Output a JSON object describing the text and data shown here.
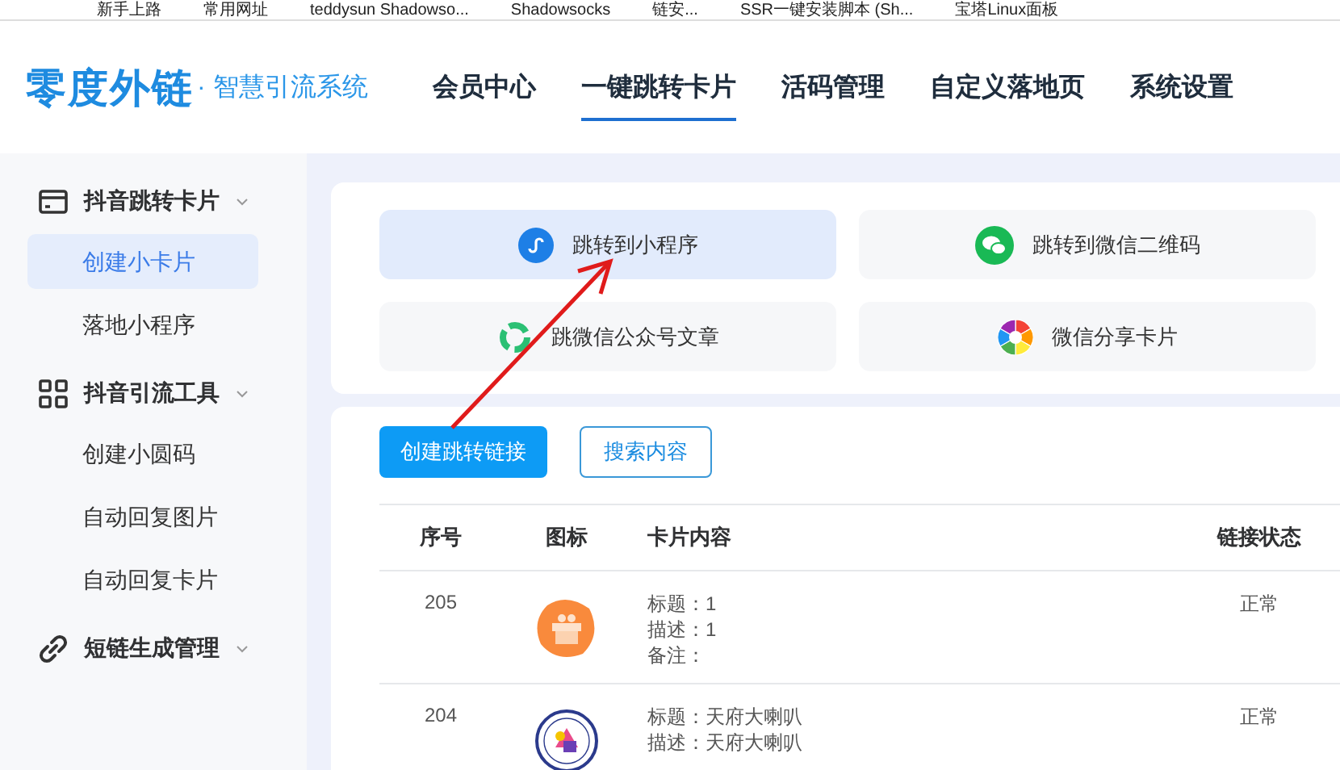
{
  "bookmarks": [
    "新手上路",
    "常用网址",
    "teddysun Shadowso...",
    "Shadowsocks",
    "链安...",
    "SSR一键安装脚本 (Sh...",
    "宝塔Linux面板"
  ],
  "logo": {
    "name": "零度外链",
    "tagline": "· 智慧引流系统"
  },
  "nav": [
    {
      "label": "会员中心",
      "selected": false
    },
    {
      "label": "一键跳转卡片",
      "selected": true
    },
    {
      "label": "活码管理",
      "selected": false
    },
    {
      "label": "自定义落地页",
      "selected": false
    },
    {
      "label": "系统设置",
      "selected": false
    }
  ],
  "sidebar": [
    {
      "label": "抖音跳转卡片",
      "kind": "card",
      "expanded": true,
      "children": [
        {
          "label": "创建小卡片",
          "selected": true
        },
        {
          "label": "落地小程序",
          "selected": false
        }
      ]
    },
    {
      "label": "抖音引流工具",
      "kind": "grid",
      "expanded": true,
      "children": [
        {
          "label": "创建小圆码",
          "selected": false
        },
        {
          "label": "自动回复图片",
          "selected": false
        },
        {
          "label": "自动回复卡片",
          "selected": false
        }
      ]
    },
    {
      "label": "短链生成管理",
      "kind": "link",
      "expanded": true
    }
  ],
  "options": [
    {
      "label": "跳转到小程序",
      "kind": "miniprogram",
      "selected": true
    },
    {
      "label": "跳转到微信二维码",
      "kind": "wechat",
      "selected": false
    },
    {
      "label": "跳微信公众号文章",
      "kind": "official",
      "selected": false
    },
    {
      "label": "微信分享卡片",
      "kind": "share",
      "selected": false
    }
  ],
  "buttons": [
    {
      "label": "创建跳转链接",
      "kind": "primary"
    },
    {
      "label": "搜索内容",
      "kind": "outline"
    }
  ],
  "table": {
    "columns": [
      "序号",
      "图标",
      "卡片内容",
      "链接状态"
    ],
    "rows": [
      {
        "id": "205",
        "kind": "gift",
        "lines": [
          "标题：1",
          "描述：1",
          "备注："
        ],
        "status": "正常"
      },
      {
        "id": "204",
        "kind": "badge",
        "lines": [
          "标题：天府大喇叭",
          "描述：天府大喇叭"
        ],
        "status": "正常"
      }
    ]
  }
}
